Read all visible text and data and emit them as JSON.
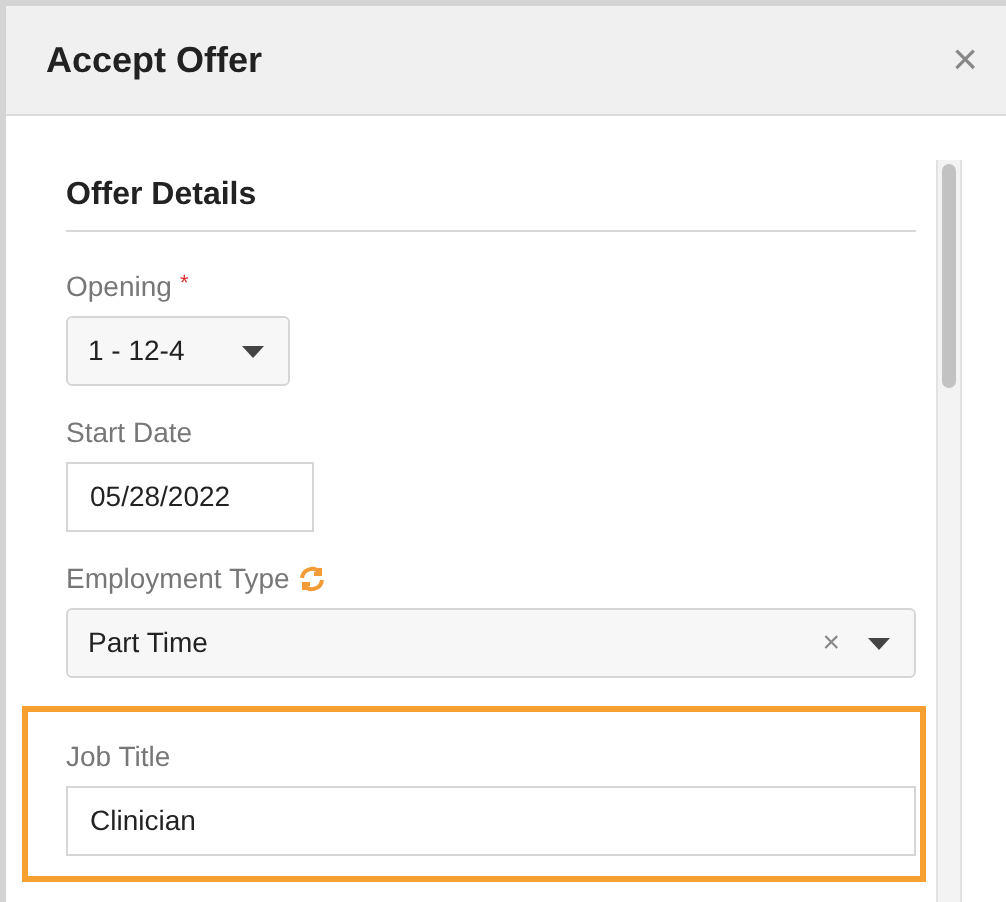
{
  "dialog": {
    "title": "Accept Offer",
    "close": "×"
  },
  "section": {
    "title": "Offer Details"
  },
  "fields": [
    {
      "kind": "select",
      "label": "Opening",
      "required_mark": "*",
      "value": "1 - 12-4"
    },
    {
      "kind": "text",
      "label": "Start Date",
      "value": "05/28/2022"
    },
    {
      "kind": "select",
      "label": "Employment Type",
      "value": "Part Time",
      "clear": "×",
      "sync_icon": true
    },
    {
      "kind": "text",
      "label": "Job Title",
      "value": "Clinician",
      "highlighted": true
    }
  ]
}
